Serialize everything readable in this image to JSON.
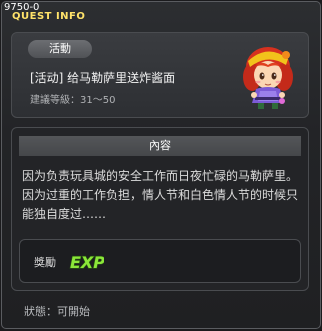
{
  "window": {
    "id_label": "9750-0",
    "title": "QUEST INFO"
  },
  "quest": {
    "category": "活動",
    "name": "[活动] 给马勒萨里送炸酱面",
    "level_label": "建議等級：",
    "level_range": "31～50",
    "npc_icon": "npc-portrait-icon"
  },
  "content": {
    "header": "內容",
    "body": "因为负责玩具城的安全工作而日夜忙碌的马勒萨里。因为过重的工作负担，情人节和白色情人节的时候只能独自度过……"
  },
  "reward": {
    "label": "獎勵",
    "exp_icon_text": "EXP"
  },
  "status": {
    "label": "狀態：",
    "value": "可開始"
  },
  "colors": {
    "title": "#ffe36a",
    "exp_fill": "#8be63a",
    "exp_outline": "#2a5a10"
  }
}
